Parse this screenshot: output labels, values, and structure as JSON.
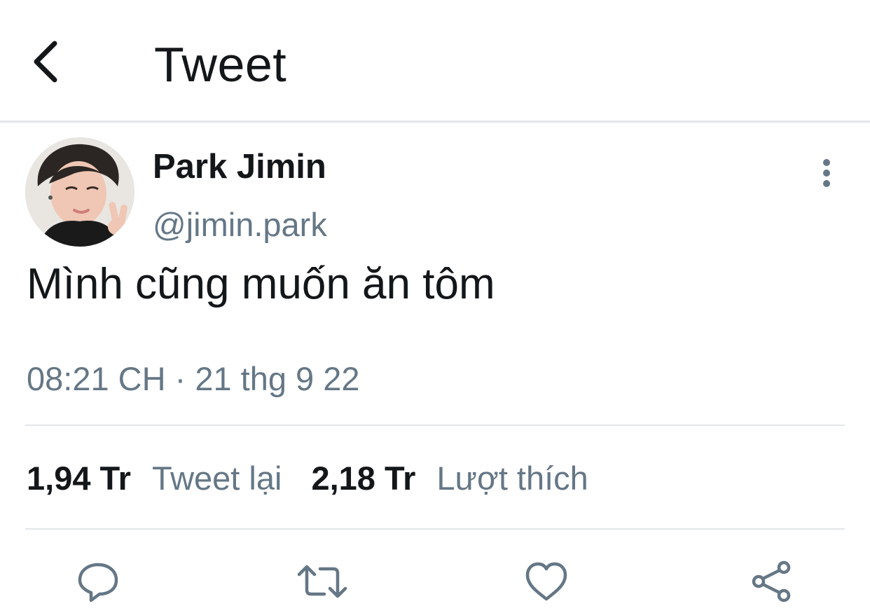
{
  "header": {
    "title": "Tweet",
    "back_icon": "chevron-left-icon"
  },
  "tweet": {
    "author": {
      "display_name": "Park Jimin",
      "handle": "@jimin.park",
      "avatar_icon": "avatar-photo"
    },
    "more_icon": "vertical-ellipsis-icon",
    "text": "Mình cũng muốn ăn tôm",
    "timestamp": "08:21 CH · 21 thg 9 22",
    "stats": {
      "retweets_count": "1,94 Tr",
      "retweets_label": "Tweet lại",
      "likes_count": "2,18 Tr",
      "likes_label": "Lượt thích"
    }
  },
  "actions": [
    {
      "name": "reply",
      "icon": "speech-bubble-icon"
    },
    {
      "name": "retweet",
      "icon": "retweet-arrows-icon"
    },
    {
      "name": "like",
      "icon": "heart-icon"
    },
    {
      "name": "share",
      "icon": "share-nodes-icon"
    }
  ],
  "colors": {
    "text_primary": "#14171a",
    "text_secondary": "#657786",
    "divider": "#e1e6ea",
    "icon": "#657786"
  }
}
